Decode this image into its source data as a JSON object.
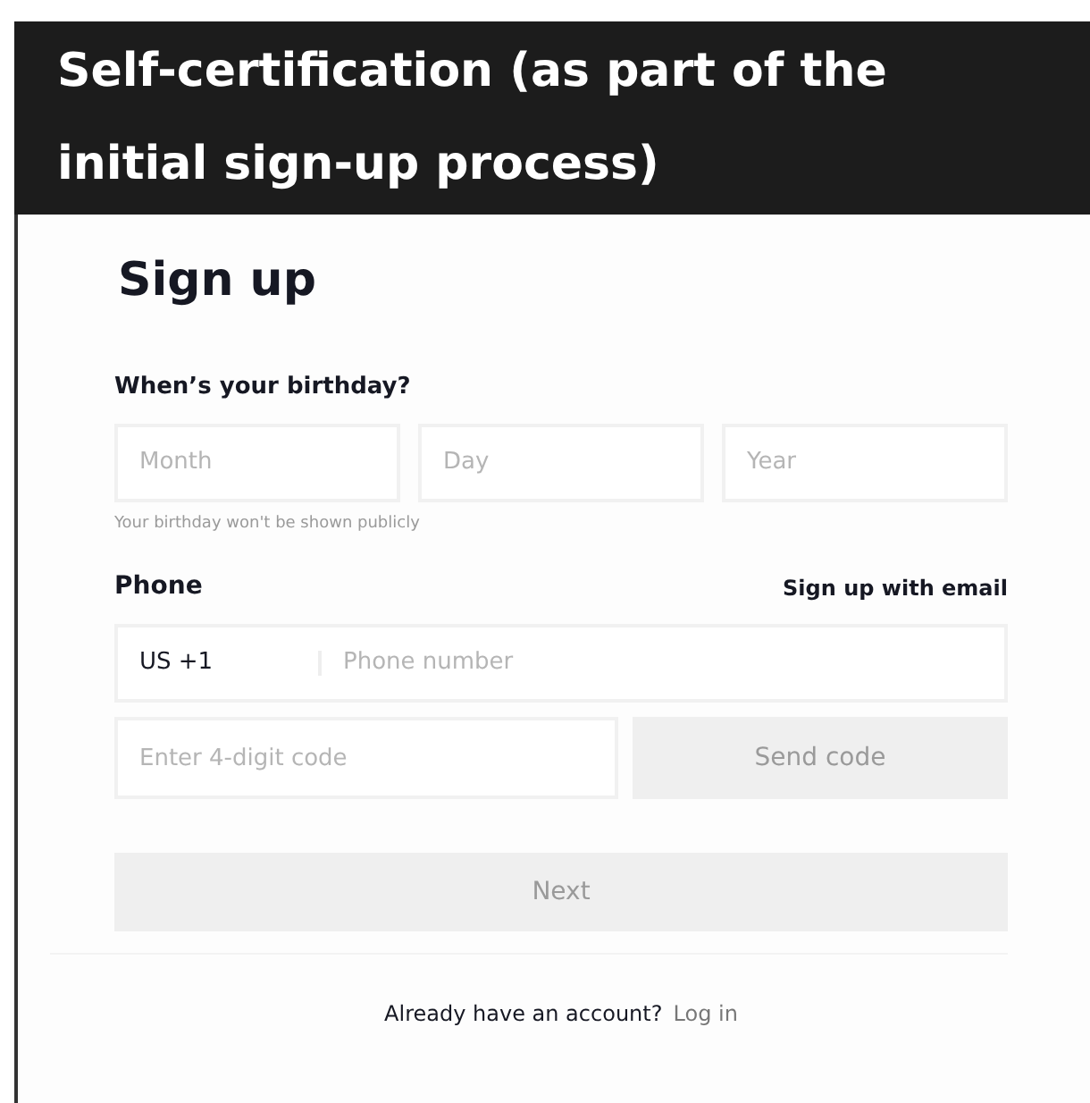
{
  "banner": {
    "title": "Self-certification (as part of the initial sign-up process)"
  },
  "form": {
    "heading": "Sign up",
    "birthday": {
      "label": "When’s your birthday?",
      "fields": [
        {
          "placeholder": "Month"
        },
        {
          "placeholder": "Day"
        },
        {
          "placeholder": "Year"
        }
      ],
      "hint": "Your birthday won't be shown publicly"
    },
    "phone": {
      "label": "Phone",
      "switch_link": "Sign up with email",
      "country": "US +1",
      "number": {
        "placeholder": "Phone number"
      },
      "code": {
        "placeholder": "Enter 4-digit code"
      },
      "send_button": {
        "label": "Send code",
        "disabled": true
      }
    },
    "next_button": {
      "label": "Next",
      "disabled": true
    },
    "footer": {
      "text": "Already have an account?",
      "link": "Log in"
    }
  }
}
